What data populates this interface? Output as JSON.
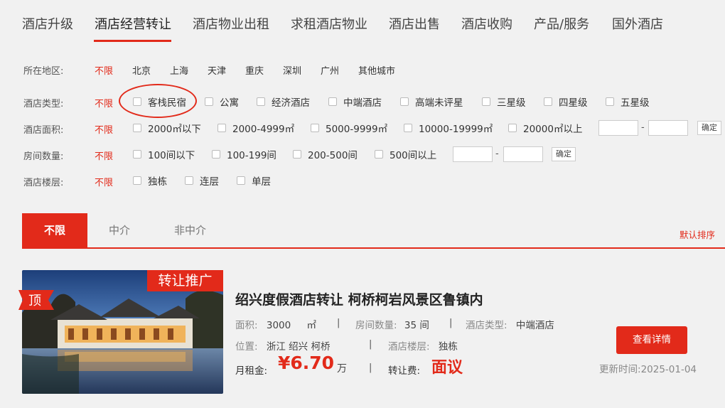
{
  "nav": {
    "tabs": [
      {
        "label": "酒店升级"
      },
      {
        "label": "酒店经营转让",
        "active": true
      },
      {
        "label": "酒店物业出租"
      },
      {
        "label": "求租酒店物业"
      },
      {
        "label": "酒店出售"
      },
      {
        "label": "酒店收购"
      },
      {
        "label": "产品/服务"
      },
      {
        "label": "国外酒店"
      }
    ]
  },
  "filters": {
    "region": {
      "label": "所在地区:",
      "options": [
        "不限",
        "北京",
        "上海",
        "天津",
        "重庆",
        "深圳",
        "广州",
        "其他城市"
      ]
    },
    "type": {
      "label": "酒店类型:",
      "any": "不限",
      "options": [
        "客栈民宿",
        "公寓",
        "经济酒店",
        "中端酒店",
        "高端未评星",
        "三星级",
        "四星级",
        "五星级"
      ]
    },
    "area": {
      "label": "酒店面积:",
      "any": "不限",
      "options": [
        "2000㎡以下",
        "2000-4999㎡",
        "5000-9999㎡",
        "10000-19999㎡",
        "20000㎡以上"
      ],
      "range_dash": "-",
      "confirm": "确定"
    },
    "rooms": {
      "label": "房间数量:",
      "any": "不限",
      "options": [
        "100间以下",
        "100-199间",
        "200-500间",
        "500间以上"
      ],
      "range_dash": "-",
      "confirm": "确定"
    },
    "floors": {
      "label": "酒店楼层:",
      "any": "不限",
      "options": [
        "独栋",
        "连层",
        "单层"
      ]
    }
  },
  "sort": {
    "tabs": [
      "不限",
      "中介",
      "非中介"
    ],
    "default_sort": "默认排序"
  },
  "listing": {
    "promo": "转让推广",
    "top_badge": "顶",
    "title": "绍兴度假酒店转让 柯桥柯岩风景区鲁镇内",
    "area_label": "面积:",
    "area_value": "3000",
    "area_unit": "㎡",
    "rooms_label": "房间数量:",
    "rooms_value": "35 间",
    "type_label": "酒店类型:",
    "type_value": "中端酒店",
    "location_label": "位置:",
    "location_value": "浙江 绍兴 柯桥",
    "floors_label": "酒店楼层:",
    "floors_value": "独栋",
    "rent_label": "月租金:",
    "rent_value": "¥6.70",
    "rent_unit": "万",
    "fee_label": "转让费:",
    "fee_value": "面议",
    "detail_button": "查看详情",
    "updated_label": "更新时间:",
    "updated_value": "2025-01-04",
    "separator": "|"
  },
  "colors": {
    "accent": "#e22a1a",
    "background": "#f1f1f1"
  }
}
